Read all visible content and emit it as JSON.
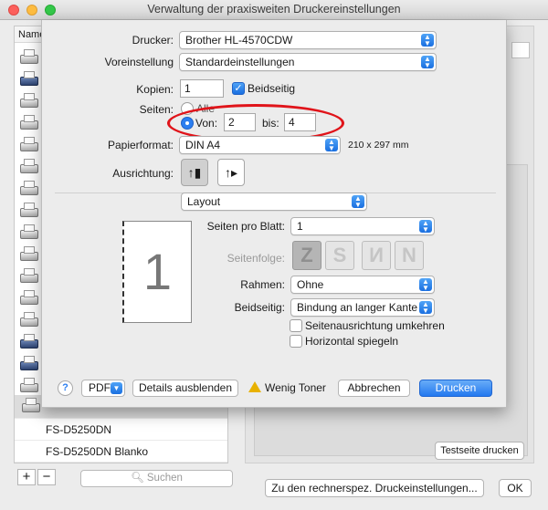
{
  "window": {
    "title": "Verwaltung der praxisweiten Druckereinstellungen"
  },
  "printer_list": {
    "header": "Name",
    "rows": [
      {
        "label": "FS-D5250DN"
      },
      {
        "label": "FS-D5250DN Blanko"
      }
    ],
    "search_placeholder": "Suchen",
    "add_label": "+",
    "remove_label": "−"
  },
  "right_panel": {
    "test_page_button": "Testseite drucken",
    "computer_settings_button": "Zu den rechnerspez. Druckeinstellungen...",
    "ok_button": "OK"
  },
  "dialog": {
    "printer_label": "Drucker:",
    "printer_value": "Brother HL-4570CDW",
    "preset_label": "Voreinstellung",
    "preset_value": "Standardeinstellungen",
    "copies_label": "Kopien:",
    "copies_value": "1",
    "duplex_label": "Beidseitig",
    "pages_label": "Seiten:",
    "pages_all": "Alle",
    "pages_from": "Von:",
    "pages_from_value": "2",
    "pages_to": "bis:",
    "pages_to_value": "4",
    "paper_label": "Papierformat:",
    "paper_value": "DIN A4",
    "paper_size": "210 x 297 mm",
    "orientation_label": "Ausrichtung:",
    "section_value": "Layout",
    "preview_number": "1",
    "pages_per_sheet_label": "Seiten pro Blatt:",
    "pages_per_sheet_value": "1",
    "page_order_label": "Seitenfolge:",
    "page_order_glyphs": [
      "Z",
      "S",
      "N",
      "N"
    ],
    "border_label": "Rahmen:",
    "border_value": "Ohne",
    "duplex2_label": "Beidseitig:",
    "duplex2_value": "Bindung an langer Kante",
    "reverse_orientation": "Seitenausrichtung umkehren",
    "flip_horizontal": "Horizontal spiegeln",
    "help": "?",
    "pdf": "PDF",
    "details": "Details ausblenden",
    "toner": "Wenig Toner",
    "cancel": "Abbrechen",
    "print": "Drucken"
  },
  "colors": {
    "accent": "#2378ef",
    "annotation": "#e0141a"
  }
}
